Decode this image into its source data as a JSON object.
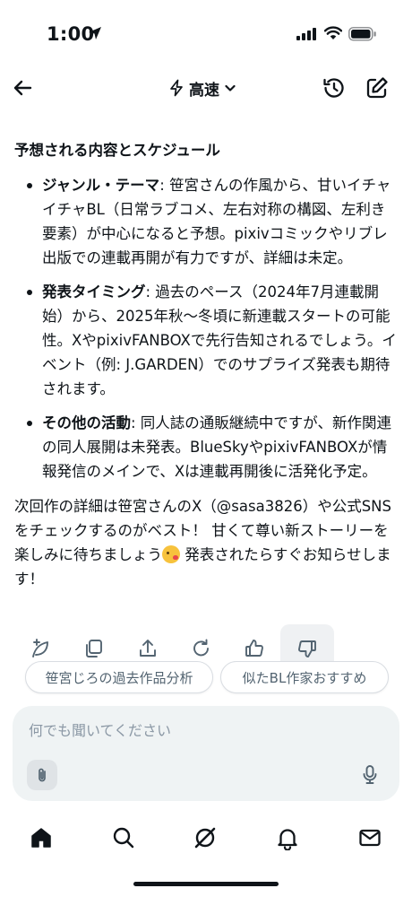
{
  "status_bar": {
    "time": "1:00",
    "icons": [
      "location-arrow-icon",
      "cellular-signal-icon",
      "wifi-icon",
      "battery-icon"
    ]
  },
  "header": {
    "back_icon": "arrow-left-icon",
    "mode_icon": "lightning-icon",
    "mode_label": "高速",
    "mode_chevron_icon": "chevron-down-icon",
    "history_icon": "history-icon",
    "edit_icon": "compose-icon"
  },
  "content": {
    "section_title": "予想される内容とスケジュール",
    "bullets": [
      {
        "title": "ジャンル・テーマ",
        "text": ": 笹宮さんの作風から、甘いイチャイチャBL（日常ラブコメ、左右対称の構図、左利き要素）が中心になると予想。pixivコミックやリブレ出版での連載再開が有力ですが、詳細は未定。"
      },
      {
        "title": "発表タイミング",
        "text": ": 過去のペース（2024年7月連載開始）から、2025年秋〜冬頃に新連載スタートの可能性。XやpixivFANBOXで先行告知されるでしょう。イベント（例: J.GARDEN）でのサプライズ発表も期待されます。"
      },
      {
        "title": "その他の活動",
        "text": ": 同人誌の通販継続中ですが、新作関連の同人展開は未発表。BlueSkyやpixivFANBOXが情報発信のメインで、Xは連載再開後に活発化予定。"
      }
    ],
    "closing_before_emoji": "次回作の詳細は笹宮さんのX（@sasa3826）や公式SNSをチェックするのがベスト！ 甘くて尊い新ストーリーを楽しみに待ちましょう",
    "closing_emoji_icon": "kissing-face-emoji-icon",
    "closing_after_emoji": " 発表されたらすぐお知らせします！"
  },
  "actions": {
    "icons": [
      "regenerate-leaf-icon",
      "copy-icon",
      "share-icon",
      "refresh-icon",
      "thumbs-up-icon",
      "thumbs-down-icon"
    ],
    "highlighted": "thumbs-down-icon"
  },
  "suggestions": [
    "笹宮じろの過去作品分析",
    "似たBL作家おすすめ"
  ],
  "composer": {
    "placeholder": "何でも聞いてください",
    "attach_icon": "paperclip-icon",
    "mic_icon": "microphone-icon"
  },
  "tab_bar": {
    "items": [
      "home-icon",
      "search-icon",
      "grok-icon",
      "notifications-icon",
      "messages-icon"
    ]
  },
  "colors": {
    "text": "#0f1419",
    "muted": "#536471",
    "composer_bg": "#eff3f4",
    "placeholder": "#8b98a5"
  }
}
